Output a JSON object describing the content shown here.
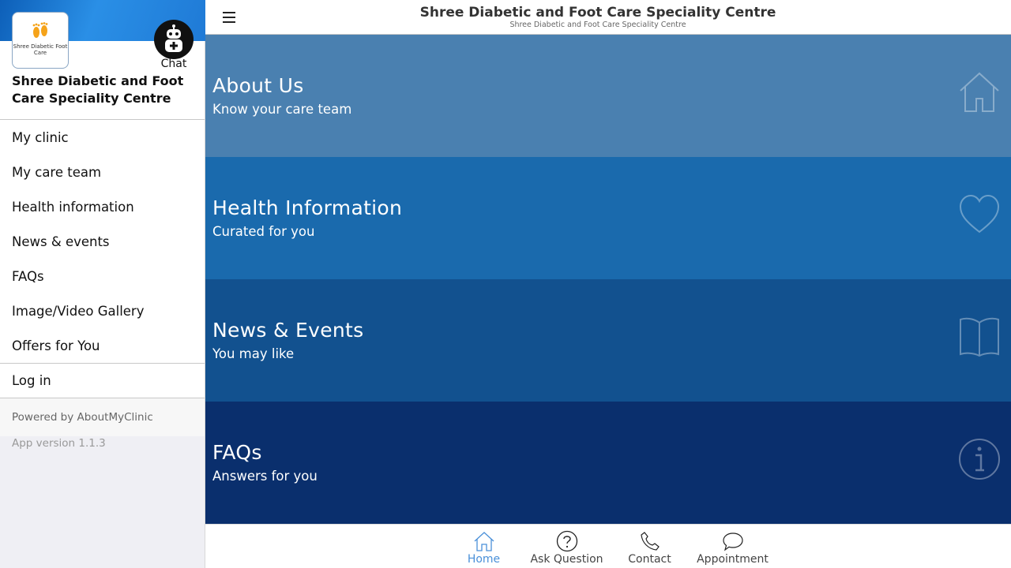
{
  "sidebar": {
    "logo_text": "Shree Diabetic Foot Care",
    "chat_label": "Chat",
    "clinic_name": "Shree Diabetic and Foot Care Speciality Centre",
    "items": [
      {
        "label": "My clinic"
      },
      {
        "label": "My care team"
      },
      {
        "label": "Health information"
      },
      {
        "label": "News & events"
      },
      {
        "label": "FAQs"
      },
      {
        "label": "Image/Video Gallery"
      },
      {
        "label": "Offers for You"
      }
    ],
    "login_label": "Log in",
    "powered_by": "Powered by AboutMyClinic",
    "app_version": "App version 1.1.3"
  },
  "header": {
    "title": "Shree Diabetic and Foot Care Speciality Centre",
    "subtitle": "Shree Diabetic and Foot Care Speciality Centre"
  },
  "tiles": [
    {
      "title": "About Us",
      "subtitle": "Know your care team",
      "icon": "home-icon",
      "color": "#4a80b0"
    },
    {
      "title": "Health Information",
      "subtitle": "Curated for you",
      "icon": "heart-icon",
      "color": "#1a6aad"
    },
    {
      "title": "News & Events",
      "subtitle": "You may like",
      "icon": "book-icon",
      "color": "#12518f"
    },
    {
      "title": "FAQs",
      "subtitle": "Answers for you",
      "icon": "info-icon",
      "color": "#0a2f6d"
    }
  ],
  "tabbar": {
    "active_color": "#4a90d9",
    "tabs": [
      {
        "label": "Home",
        "icon": "home-icon",
        "active": true
      },
      {
        "label": "Ask Question",
        "icon": "question-icon",
        "active": false
      },
      {
        "label": "Contact",
        "icon": "phone-icon",
        "active": false
      },
      {
        "label": "Appointment",
        "icon": "chat-bubble-icon",
        "active": false
      }
    ]
  }
}
